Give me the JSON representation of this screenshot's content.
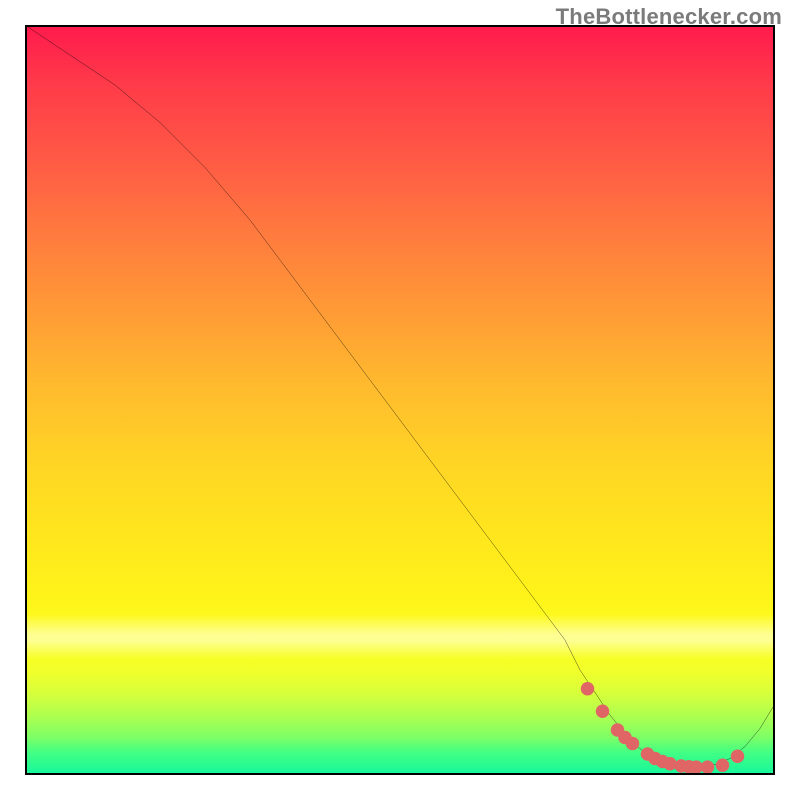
{
  "watermark": "TheBottlenecker.com",
  "chart_data": {
    "type": "line",
    "title": "",
    "xlabel": "",
    "ylabel": "",
    "xlim": [
      0,
      100
    ],
    "ylim": [
      0,
      100
    ],
    "grid": false,
    "curve": {
      "name": "bottleneck-curve",
      "color": "#000000",
      "x": [
        0,
        6,
        12,
        18,
        24,
        30,
        36,
        42,
        48,
        54,
        60,
        66,
        72,
        74,
        76,
        78,
        80,
        82,
        84,
        86,
        88,
        90,
        92,
        94,
        96,
        98,
        100
      ],
      "y": [
        100,
        96,
        92,
        87,
        81,
        74,
        66,
        58,
        50,
        42,
        34,
        26,
        18,
        14,
        11,
        8,
        5.5,
        3.5,
        2.2,
        1.4,
        1,
        1,
        1.4,
        2.2,
        3.8,
        6.2,
        9.5
      ]
    },
    "markers": {
      "name": "data-points",
      "color": "#e06666",
      "x": [
        75,
        77,
        79,
        80,
        81,
        83,
        84,
        85,
        86,
        87.5,
        88.5,
        89.5,
        91,
        93,
        95
      ],
      "y": [
        11.5,
        8.5,
        6,
        5,
        4.2,
        2.8,
        2.2,
        1.8,
        1.5,
        1.2,
        1.1,
        1.05,
        1.05,
        1.3,
        2.5
      ]
    },
    "background": {
      "type": "vertical-gradient",
      "stops": [
        {
          "pos": 0,
          "color": "#ff1a4d"
        },
        {
          "pos": 0.5,
          "color": "#ffd425"
        },
        {
          "pos": 0.82,
          "color": "#fcff1f"
        },
        {
          "pos": 1,
          "color": "#14f79d"
        }
      ]
    }
  }
}
